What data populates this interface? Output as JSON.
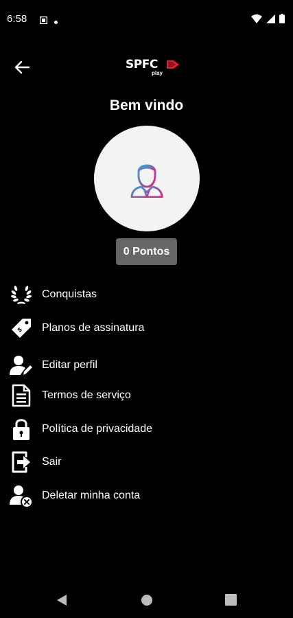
{
  "status_bar": {
    "time": "6:58"
  },
  "header": {
    "logo_text": "SPFC",
    "logo_sub": "play"
  },
  "welcome_title": "Bem vindo",
  "points_label": "0 Pontos",
  "menu": [
    {
      "label": "Conquistas",
      "icon": "laurel-icon"
    },
    {
      "label": "Planos de assinatura",
      "icon": "price-tag-icon"
    },
    {
      "label": "Editar perfil",
      "icon": "user-edit-icon"
    },
    {
      "label": "Termos de serviço",
      "icon": "document-icon"
    },
    {
      "label": "Política de privacidade",
      "icon": "lock-icon"
    },
    {
      "label": "Sair",
      "icon": "exit-icon"
    },
    {
      "label": "Deletar minha conta",
      "icon": "user-delete-icon"
    }
  ],
  "colors": {
    "background": "#000000",
    "badge": "#666666",
    "avatar_bg": "#f3f3f3",
    "brand_red": "#e0202e",
    "avatar_gradient_start": "#2aa7e0",
    "avatar_gradient_end": "#e0207a"
  }
}
